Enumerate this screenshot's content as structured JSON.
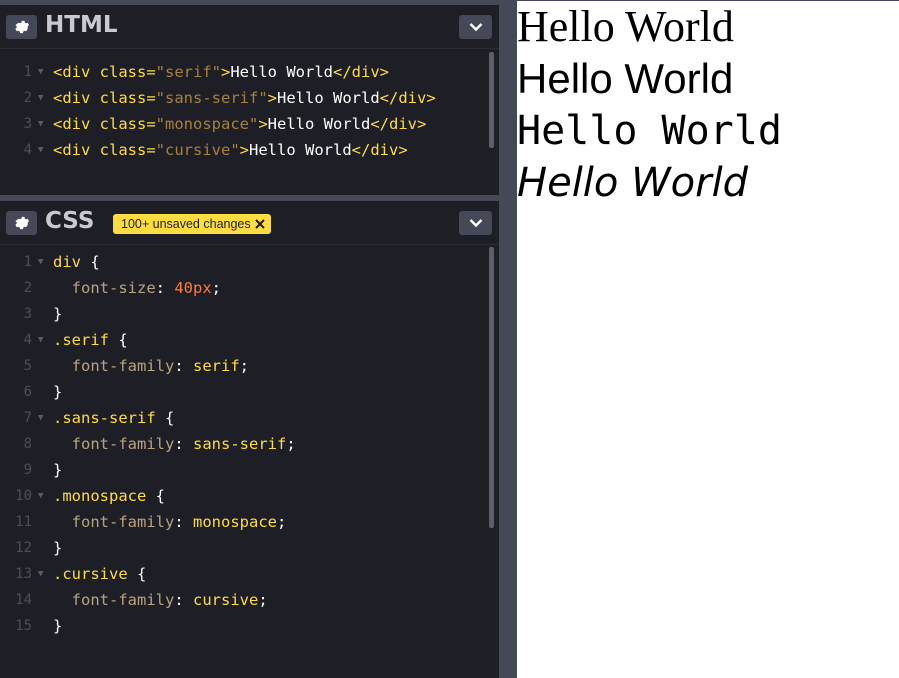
{
  "html_panel": {
    "title": "HTML",
    "lines": [
      {
        "n": "1",
        "open": "<div",
        "attr": "class=",
        "value": "\"serif\"",
        "close": ">",
        "text": "Hello World",
        "end": "</div>"
      },
      {
        "n": "2",
        "open": "<div",
        "attr": "class=",
        "value": "\"sans-serif\"",
        "close": ">",
        "text": "Hello World",
        "end": "</div>"
      },
      {
        "n": "3",
        "open": "<div",
        "attr": "class=",
        "value": "\"monospace\"",
        "close": ">",
        "text": "Hello World",
        "end": "</div>"
      },
      {
        "n": "4",
        "open": "<div",
        "attr": "class=",
        "value": "\"cursive\"",
        "close": ">",
        "text": "Hello World",
        "end": "</div>"
      }
    ]
  },
  "css_panel": {
    "title": "CSS",
    "badge": "100+ unsaved changes",
    "lines": [
      {
        "n": "1",
        "a": "div",
        "b": " {"
      },
      {
        "n": "2",
        "prop": "font-size",
        "val": "40px"
      },
      {
        "n": "3",
        "a": "}"
      },
      {
        "n": "4",
        "a": ".serif",
        "b": " {"
      },
      {
        "n": "5",
        "prop": "font-family",
        "val": "serif"
      },
      {
        "n": "6",
        "a": "}"
      },
      {
        "n": "7",
        "a": ".sans-serif",
        "b": " {"
      },
      {
        "n": "8",
        "prop": "font-family",
        "val": "sans-serif"
      },
      {
        "n": "9",
        "a": "}"
      },
      {
        "n": "10",
        "a": ".monospace",
        "b": " {"
      },
      {
        "n": "11",
        "prop": "font-family",
        "val": "monospace"
      },
      {
        "n": "12",
        "a": "}"
      },
      {
        "n": "13",
        "a": ".cursive",
        "b": " {"
      },
      {
        "n": "14",
        "prop": "font-family",
        "val": "cursive"
      },
      {
        "n": "15",
        "a": "}"
      }
    ]
  },
  "preview": {
    "lines": [
      "Hello World",
      "Hello World",
      "Hello World",
      "Hello World"
    ]
  },
  "colors": {
    "editor_bg": "#1e1f26",
    "gutter_bg": "#444857",
    "badge": "#ffdd40",
    "number": "#ff7a3c"
  },
  "icons": {
    "settings": "gear-icon",
    "collapse": "chevron-down-icon",
    "badge_close": "close-icon"
  }
}
